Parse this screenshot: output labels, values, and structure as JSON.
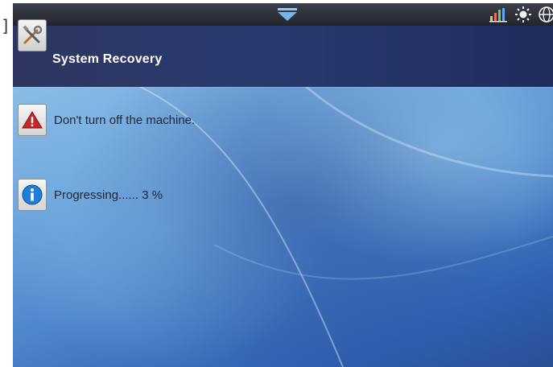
{
  "window": {
    "title": "System Recovery"
  },
  "status_bar": {
    "icons": [
      "pull-down-arrow-icon",
      "signal-bars-icon",
      "brightness-icon",
      "globe-icon"
    ]
  },
  "messages": [
    {
      "icon": "warning-icon",
      "text": "Don't turn off the machine."
    },
    {
      "icon": "info-icon",
      "text": "Progressing...... 3 %"
    }
  ],
  "progress_percent": 3,
  "colors": {
    "statusbar": "#23252d",
    "titlebar": "#2a3a70",
    "background": "#4f86cc",
    "warning": "#c62828",
    "info": "#1e7fd6"
  }
}
